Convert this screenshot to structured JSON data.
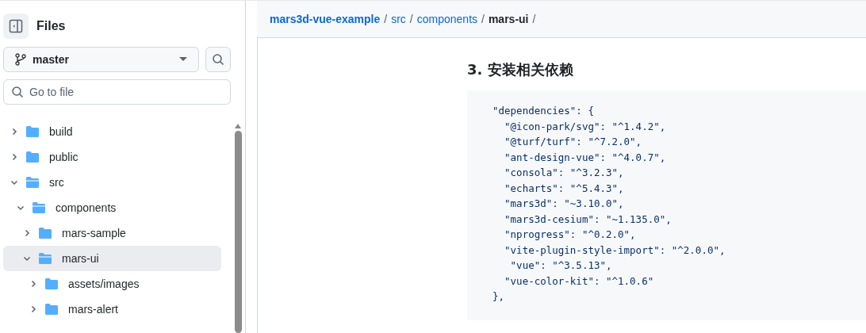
{
  "sidebar": {
    "title": "Files",
    "branch": "master",
    "search": {
      "placeholder": "Go to file"
    },
    "tree": [
      {
        "name": "build",
        "expanded": false,
        "selected": false
      },
      {
        "name": "public",
        "expanded": false,
        "selected": false
      },
      {
        "name": "src",
        "expanded": true,
        "selected": false,
        "children": [
          {
            "name": "components",
            "expanded": true,
            "selected": false,
            "children": [
              {
                "name": "mars-sample",
                "expanded": false,
                "selected": false
              },
              {
                "name": "mars-ui",
                "expanded": true,
                "selected": true,
                "children": [
                  {
                    "name": "assets/images",
                    "expanded": false,
                    "selected": false
                  },
                  {
                    "name": "mars-alert",
                    "expanded": false,
                    "selected": false
                  }
                ]
              }
            ]
          }
        ]
      }
    ]
  },
  "breadcrumb": [
    {
      "label": "mars3d-vue-example",
      "link": true,
      "separator": "/"
    },
    {
      "label": "src",
      "link": true,
      "separator": "/"
    },
    {
      "label": "components",
      "link": true,
      "separator": "/"
    },
    {
      "label": "mars-ui",
      "link": false,
      "separator": "/"
    }
  ],
  "content": {
    "heading": "3. 安装相关依赖",
    "code": [
      "\"dependencies\": {",
      "  \"@icon-park/svg\": \"^1.4.2\",",
      "  \"@turf/turf\": \"^7.2.0\",",
      "  \"ant-design-vue\": \"^4.0.7\",",
      "  \"consola\": \"^3.2.3\",",
      "  \"echarts\": \"^5.4.3\",",
      "  \"mars3d\": \"~3.10.0\",",
      "  \"mars3d-cesium\": \"~1.135.0\",",
      "  \"nprogress\": \"^0.2.0\",",
      "  \"vite-plugin-style-import\": \"^2.0.0\",",
      "   \"vue\": \"^3.5.13\",",
      "  \"vue-color-kit\": \"^1.0.6\"",
      "},"
    ]
  }
}
